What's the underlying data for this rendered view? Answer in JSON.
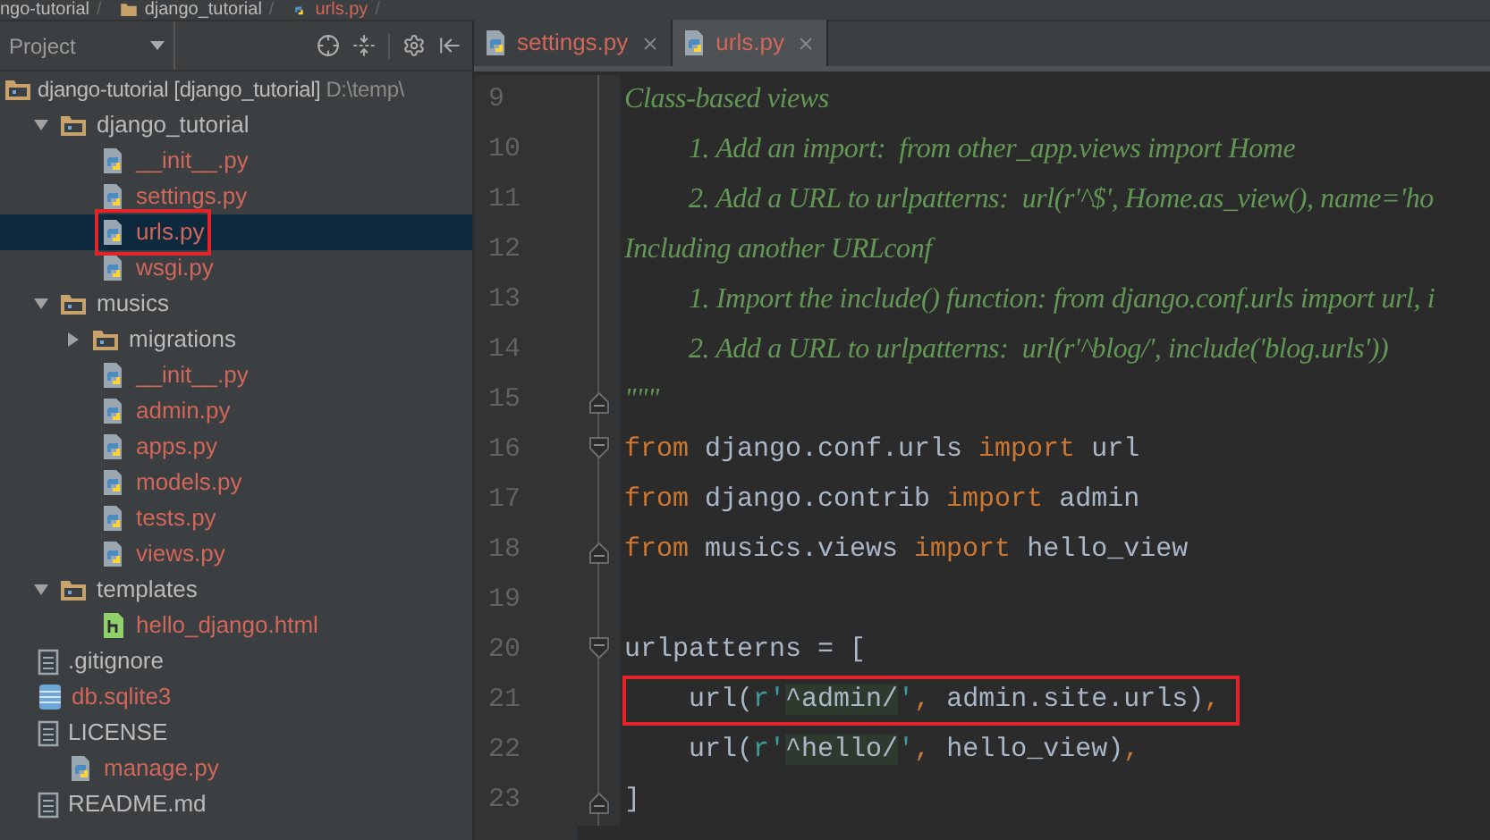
{
  "breadcrumb": [
    {
      "label": "ngo-tutorial",
      "kind": "folder",
      "separator": "/"
    },
    {
      "label": "django_tutorial",
      "kind": "folder",
      "separator": "/"
    },
    {
      "label": "urls.py",
      "kind": "python",
      "separator": "/"
    }
  ],
  "project_panel": {
    "title": "Project",
    "tree": [
      {
        "label": "django-tutorial [django_tutorial]",
        "path": "D:\\temp\\",
        "kind": "root",
        "children": [
          {
            "label": "django_tutorial",
            "kind": "package",
            "expanded": true,
            "children": [
              {
                "label": "__init__.py",
                "kind": "python",
                "unversioned": true,
                "selected": false,
                "annotated": false
              },
              {
                "label": "settings.py",
                "kind": "python",
                "unversioned": true,
                "selected": false,
                "annotated": false
              },
              {
                "label": "urls.py",
                "kind": "python",
                "unversioned": true,
                "selected": true,
                "annotated": true
              },
              {
                "label": "wsgi.py",
                "kind": "python",
                "unversioned": true,
                "selected": false,
                "annotated": false
              }
            ]
          },
          {
            "label": "musics",
            "kind": "package",
            "expanded": true,
            "children": [
              {
                "label": "migrations",
                "kind": "package",
                "expanded": false
              },
              {
                "label": "__init__.py",
                "kind": "python",
                "unversioned": true,
                "selected": false,
                "annotated": false
              },
              {
                "label": "admin.py",
                "kind": "python",
                "unversioned": true,
                "selected": false,
                "annotated": false
              },
              {
                "label": "apps.py",
                "kind": "python",
                "unversioned": true,
                "selected": false,
                "annotated": false
              },
              {
                "label": "models.py",
                "kind": "python",
                "unversioned": true,
                "selected": false,
                "annotated": false
              },
              {
                "label": "tests.py",
                "kind": "python",
                "unversioned": true,
                "selected": false,
                "annotated": false
              },
              {
                "label": "views.py",
                "kind": "python",
                "unversioned": true,
                "selected": false,
                "annotated": false
              }
            ]
          },
          {
            "label": "templates",
            "kind": "package",
            "expanded": true,
            "children": [
              {
                "label": "hello_django.html",
                "kind": "html",
                "unversioned": true,
                "selected": false,
                "annotated": false
              }
            ]
          },
          {
            "label": ".gitignore",
            "kind": "text",
            "unversioned": false,
            "selected": false,
            "annotated": false
          },
          {
            "label": "db.sqlite3",
            "kind": "db",
            "unversioned": true,
            "selected": false,
            "annotated": false
          },
          {
            "label": "LICENSE",
            "kind": "text",
            "unversioned": false,
            "selected": false,
            "annotated": false
          },
          {
            "label": "manage.py",
            "kind": "python",
            "unversioned": true,
            "selected": false,
            "annotated": false
          },
          {
            "label": "README.md",
            "kind": "text",
            "unversioned": false,
            "selected": false,
            "annotated": false
          }
        ]
      }
    ]
  },
  "tabs": [
    {
      "label": "settings.py",
      "selected": false
    },
    {
      "label": "urls.py",
      "selected": true
    }
  ],
  "code_lines": [
    {
      "number": "9",
      "indented": false,
      "fold_start": false,
      "fold_end": false,
      "annotated": false,
      "segments": [
        {
          "kind": "comment",
          "text": "Class-based views"
        }
      ]
    },
    {
      "number": "10",
      "indented": true,
      "fold_start": false,
      "fold_end": false,
      "annotated": false,
      "segments": [
        {
          "kind": "comment",
          "text": "1. Add an import:  from other_app.views import Home"
        }
      ]
    },
    {
      "number": "11",
      "indented": true,
      "fold_start": false,
      "fold_end": false,
      "annotated": false,
      "segments": [
        {
          "kind": "comment",
          "text": "2. Add a URL to urlpatterns:  url(r'^$', Home.as_view(), name='ho"
        }
      ]
    },
    {
      "number": "12",
      "indented": false,
      "fold_start": false,
      "fold_end": false,
      "annotated": false,
      "segments": [
        {
          "kind": "comment",
          "text": "Including another URLconf"
        }
      ]
    },
    {
      "number": "13",
      "indented": true,
      "fold_start": false,
      "fold_end": false,
      "annotated": false,
      "segments": [
        {
          "kind": "comment",
          "text": "1. Import the include() function: from django.conf.urls import url, i"
        }
      ]
    },
    {
      "number": "14",
      "indented": true,
      "fold_start": false,
      "fold_end": false,
      "annotated": false,
      "segments": [
        {
          "kind": "comment",
          "text": "2. Add a URL to urlpatterns:  url(r'^blog/', include('blog.urls'))"
        }
      ]
    },
    {
      "number": "15",
      "indented": false,
      "fold_start": false,
      "fold_end": true,
      "annotated": false,
      "segments": [
        {
          "kind": "comment",
          "text": "\"\"\""
        }
      ]
    },
    {
      "number": "16",
      "indented": false,
      "fold_start": true,
      "fold_end": false,
      "annotated": false,
      "segments": [
        {
          "kind": "keyword",
          "text": "from"
        },
        {
          "kind": "plain",
          "text": " django.conf.urls "
        },
        {
          "kind": "keyword",
          "text": "import"
        },
        {
          "kind": "plain",
          "text": " url"
        }
      ]
    },
    {
      "number": "17",
      "indented": false,
      "fold_start": false,
      "fold_end": false,
      "annotated": false,
      "segments": [
        {
          "kind": "keyword",
          "text": "from"
        },
        {
          "kind": "plain",
          "text": " django.contrib "
        },
        {
          "kind": "keyword",
          "text": "import"
        },
        {
          "kind": "plain",
          "text": " admin"
        }
      ]
    },
    {
      "number": "18",
      "indented": false,
      "fold_start": false,
      "fold_end": true,
      "annotated": false,
      "segments": [
        {
          "kind": "keyword",
          "text": "from"
        },
        {
          "kind": "plain",
          "text": " musics.views "
        },
        {
          "kind": "keyword",
          "text": "import"
        },
        {
          "kind": "plain",
          "text": " hello_view"
        }
      ]
    },
    {
      "number": "19",
      "fold_start": false,
      "fold_end": false
    },
    {
      "number": "20",
      "indented": false,
      "fold_start": true,
      "fold_end": false,
      "annotated": false,
      "segments": [
        {
          "kind": "plain",
          "text": "urlpatterns = ["
        }
      ]
    },
    {
      "number": "21",
      "indented": true,
      "fold_start": false,
      "fold_end": false,
      "annotated": true,
      "segments": [
        {
          "kind": "plain",
          "text": "url("
        },
        {
          "kind": "prefix",
          "text": "r'"
        },
        {
          "kind": "regex",
          "text": "^admin/"
        },
        {
          "kind": "prefix",
          "text": "'"
        },
        {
          "kind": "punct",
          "text": ","
        },
        {
          "kind": "plain",
          "text": " admin.site.urls)"
        },
        {
          "kind": "punct",
          "text": ","
        }
      ]
    },
    {
      "number": "22",
      "indented": true,
      "fold_start": false,
      "fold_end": false,
      "annotated": false,
      "segments": [
        {
          "kind": "plain",
          "text": "url("
        },
        {
          "kind": "prefix",
          "text": "r'"
        },
        {
          "kind": "regex",
          "text": "^hello/"
        },
        {
          "kind": "prefix",
          "text": "'"
        },
        {
          "kind": "punct",
          "text": ","
        },
        {
          "kind": "plain",
          "text": " hello_view)"
        },
        {
          "kind": "punct",
          "text": ","
        }
      ]
    },
    {
      "number": "23",
      "indented": false,
      "fold_start": false,
      "fold_end": true,
      "annotated": false,
      "segments": [
        {
          "kind": "plain",
          "text": "]"
        }
      ]
    }
  ]
}
